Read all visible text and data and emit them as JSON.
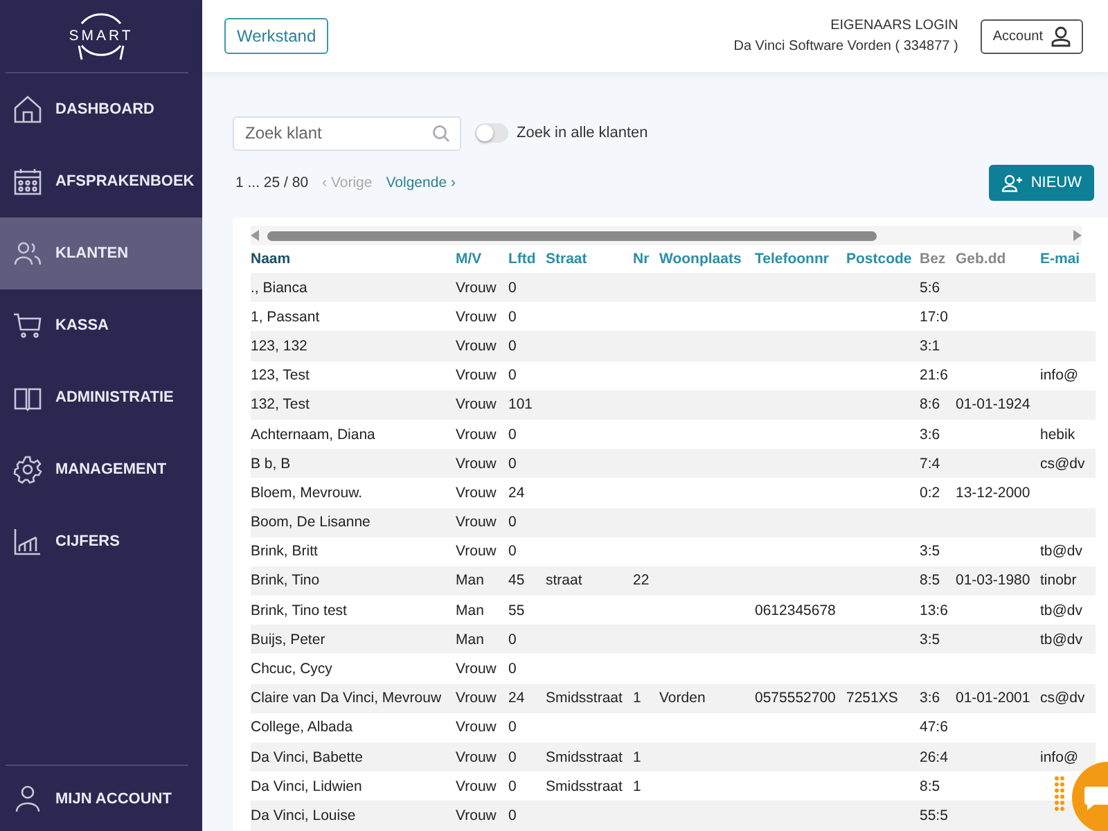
{
  "sidebar": {
    "logo": "SMART",
    "items": [
      {
        "label": "DASHBOARD",
        "selected": false
      },
      {
        "label": "AFSPRAKENBOEK",
        "selected": false
      },
      {
        "label": "KLANTEN",
        "selected": true
      },
      {
        "label": "KASSA",
        "selected": false
      },
      {
        "label": "ADMINISTRATIE",
        "selected": false
      },
      {
        "label": "MANAGEMENT",
        "selected": false
      },
      {
        "label": "CIJFERS",
        "selected": false
      }
    ],
    "account": {
      "label": "MIJN ACCOUNT",
      "selected": false
    }
  },
  "topbar": {
    "werkstand": "Werkstand",
    "login_title": "EIGENAARS LOGIN",
    "company": "Da Vinci Software Vorden ( 334877 )",
    "account": "Account"
  },
  "search": {
    "placeholder": "Zoek klant"
  },
  "toggle": {
    "label": "Zoek in alle klanten",
    "on": false
  },
  "pagination": {
    "range": "1 ... 25 / 80",
    "prev": {
      "label": "‹ Vorige",
      "disabled": true
    },
    "next": {
      "label": "Volgende ›",
      "disabled": false
    }
  },
  "new_button": "NIEUW",
  "table": {
    "columns": [
      {
        "label": "Naam",
        "sortable": true,
        "sorted": true
      },
      {
        "label": "M/V",
        "sortable": true,
        "sorted": false
      },
      {
        "label": "Lftd",
        "sortable": true,
        "sorted": false
      },
      {
        "label": "Straat",
        "sortable": true,
        "sorted": false
      },
      {
        "label": "Nr",
        "sortable": true,
        "sorted": false
      },
      {
        "label": "Woonplaats",
        "sortable": true,
        "sorted": false
      },
      {
        "label": "Telefoonnr",
        "sortable": true,
        "sorted": false
      },
      {
        "label": "Postcode",
        "sortable": true,
        "sorted": false
      },
      {
        "label": "Bez",
        "sortable": false,
        "sorted": false
      },
      {
        "label": "Geb.dd",
        "sortable": false,
        "sorted": false
      },
      {
        "label": "E-mai",
        "sortable": true,
        "sorted": false
      }
    ],
    "rows": [
      [
        "., Bianca",
        "Vrouw",
        "0",
        null,
        null,
        null,
        null,
        null,
        "5:6",
        null,
        null
      ],
      [
        "1, Passant",
        "Vrouw",
        "0",
        null,
        null,
        null,
        null,
        null,
        "17:0",
        null,
        null
      ],
      [
        "123, 132",
        "Vrouw",
        "0",
        null,
        null,
        null,
        null,
        null,
        "3:1",
        null,
        null
      ],
      [
        "123, Test",
        "Vrouw",
        "0",
        null,
        null,
        null,
        null,
        null,
        "21:6",
        null,
        "info@"
      ],
      [
        "132, Test",
        "Vrouw",
        "101",
        null,
        null,
        null,
        null,
        null,
        "8:6",
        "01-01-1924",
        null
      ],
      [
        "Achternaam, Diana",
        "Vrouw",
        "0",
        null,
        null,
        null,
        null,
        null,
        "3:6",
        null,
        "hebik"
      ],
      [
        "B b, B",
        "Vrouw",
        "0",
        null,
        null,
        null,
        null,
        null,
        "7:4",
        null,
        "cs@dv"
      ],
      [
        "Bloem, Mevrouw.",
        "Vrouw",
        "24",
        null,
        null,
        null,
        null,
        null,
        "0:2",
        "13-12-2000",
        null
      ],
      [
        "Boom, De Lisanne",
        "Vrouw",
        "0",
        null,
        null,
        null,
        null,
        null,
        null,
        null,
        null
      ],
      [
        "Brink, Britt",
        "Vrouw",
        "0",
        null,
        null,
        null,
        null,
        null,
        "3:5",
        null,
        "tb@dv"
      ],
      [
        "Brink, Tino",
        "Man",
        "45",
        "straat",
        "22",
        null,
        null,
        null,
        "8:5",
        "01-03-1980",
        "tinobr"
      ],
      [
        "Brink, Tino test",
        "Man",
        "55",
        null,
        null,
        null,
        "0612345678",
        null,
        "13:6",
        null,
        "tb@dv"
      ],
      [
        "Buijs, Peter",
        "Man",
        "0",
        null,
        null,
        null,
        null,
        null,
        "3:5",
        null,
        "tb@dv"
      ],
      [
        "Chcuc, Cycy",
        "Vrouw",
        "0",
        null,
        null,
        null,
        null,
        null,
        null,
        null,
        null
      ],
      [
        "Claire van Da Vinci, Mevrouw",
        "Vrouw",
        "24",
        "Smidsstraat",
        "1",
        "Vorden",
        "0575552700",
        "7251XS",
        "3:6",
        "01-01-2001",
        "cs@dv"
      ],
      [
        "College, Albada",
        "Vrouw",
        "0",
        null,
        null,
        null,
        null,
        null,
        "47:6",
        null,
        null
      ],
      [
        "Da Vinci, Babette",
        "Vrouw",
        "0",
        "Smidsstraat",
        "1",
        null,
        null,
        null,
        "26:4",
        null,
        "info@"
      ],
      [
        "Da Vinci, Lidwien",
        "Vrouw",
        "0",
        "Smidsstraat",
        "1",
        null,
        null,
        null,
        "8:5",
        null,
        null
      ],
      [
        "Da Vinci, Louise",
        "Vrouw",
        "0",
        null,
        null,
        null,
        null,
        null,
        "55:5",
        null,
        null
      ]
    ]
  }
}
